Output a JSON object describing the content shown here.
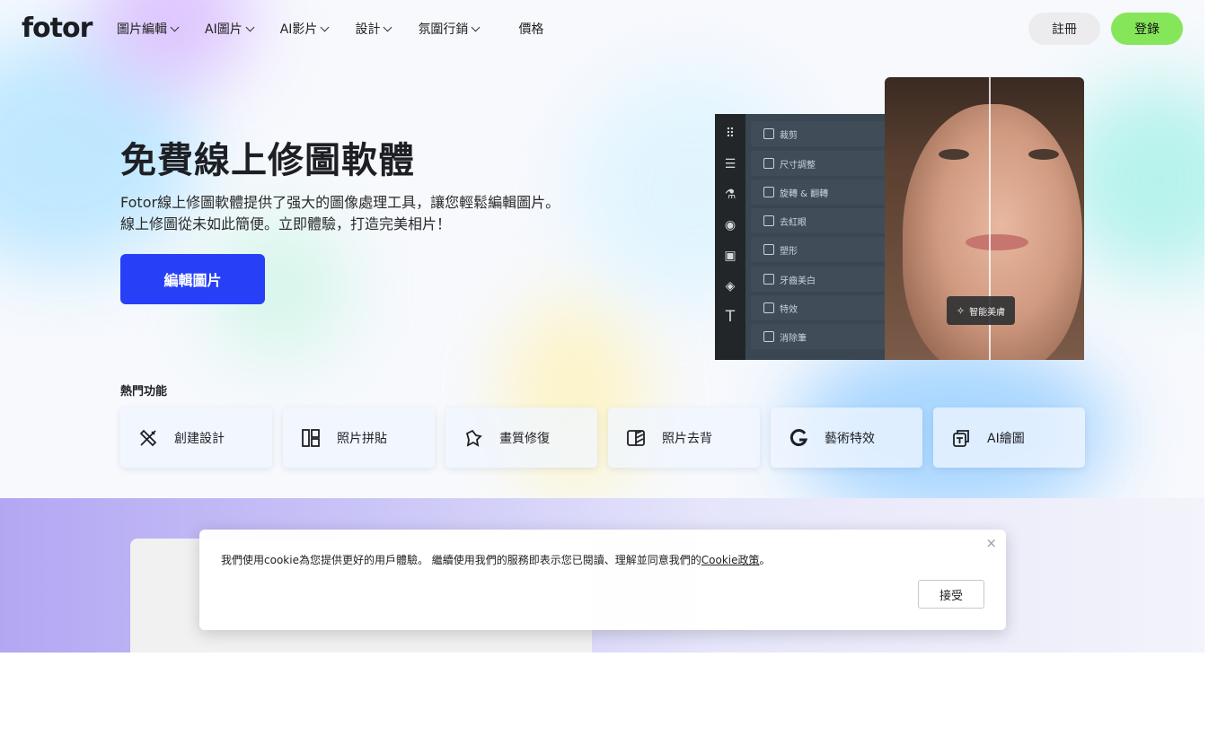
{
  "header": {
    "logo": "fotor",
    "nav": [
      {
        "label": "圖片編輯",
        "has_dropdown": true
      },
      {
        "label": "AI圖片",
        "has_dropdown": true
      },
      {
        "label": "AI影片",
        "has_dropdown": true
      },
      {
        "label": "設計",
        "has_dropdown": true
      },
      {
        "label": "氛圍行銷",
        "has_dropdown": true
      },
      {
        "label": "價格",
        "has_dropdown": false
      }
    ],
    "register_label": "註冊",
    "login_label": "登錄"
  },
  "hero": {
    "title": "免費線上修圖軟體",
    "subtitle_line1": "Fotor線上修圖軟體提供了强大的圖像處理工具，讓您輕鬆編輯圖片。",
    "subtitle_line2": "線上修圖從未如此簡便。立即體驗，打造完美相片！",
    "cta_label": "編輯圖片"
  },
  "editor_mock": {
    "menu": [
      "裁剪",
      "尺寸調整",
      "旋轉 & 翻轉",
      "去紅眼",
      "塑形",
      "牙齒美白",
      "特效",
      "消除筆"
    ],
    "badge": "智能美膚"
  },
  "popular": {
    "label": "熱門功能",
    "items": [
      {
        "label": "創建設計",
        "icon": "design-tools-icon"
      },
      {
        "label": "照片拼貼",
        "icon": "collage-icon"
      },
      {
        "label": "畫質修復",
        "icon": "sparkle-enhance-icon"
      },
      {
        "label": "照片去背",
        "icon": "background-remove-icon"
      },
      {
        "label": "藝術特效",
        "icon": "art-effect-icon"
      },
      {
        "label": "AI繪圖",
        "icon": "ai-art-icon"
      }
    ]
  },
  "cookie": {
    "text": "我們使用cookie為您提供更好的用戶體驗。 繼續使用我們的服務即表示您已閱讀、理解並同意我們的",
    "link": "Cookie政策",
    "suffix": "。",
    "accept_label": "接受",
    "close": "×"
  },
  "colors": {
    "accent_blue": "#2740f7",
    "login_green": "#86e659"
  }
}
